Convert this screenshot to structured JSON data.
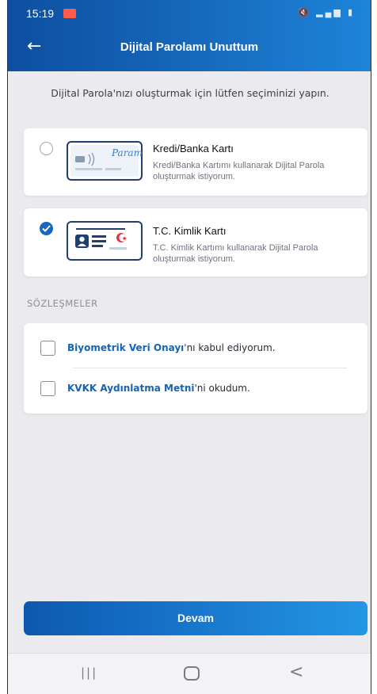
{
  "status_bar": {
    "time": "15:19"
  },
  "header": {
    "title": "Dijital Parolamı Unuttum",
    "back_icon": "arrow-left-icon"
  },
  "intro_text": "Dijital Parola'nızı oluşturmak için lütfen seçiminizi yapın.",
  "options": [
    {
      "title": "Kredi/Banka Kartı",
      "description": "Kredi/Banka Kartımı kullanarak Dijital Parola oluşturmak istiyorum.",
      "selected": false,
      "card_text": "Param"
    },
    {
      "title": "T.C. Kimlik Kartı",
      "description": "T.C. Kimlik Kartımı kullanarak Dijital Parola oluşturmak istiyorum.",
      "selected": true
    }
  ],
  "agreements": {
    "section_title": "SÖZLEŞMELER",
    "items": [
      {
        "link": "Biyometrik Veri Onayı",
        "rest": "'nı kabul ediyorum.",
        "checked": false
      },
      {
        "link": "KVKK Aydınlatma Metni",
        "rest": "'ni okudum.",
        "checked": false
      }
    ]
  },
  "continue_button": "Devam",
  "colors": {
    "primary": "#1766bf",
    "header_start": "#0d4fa0",
    "header_end": "#1d84d9",
    "background": "#eaeaef"
  },
  "navigation": {
    "recent_icon": "recent-apps-icon",
    "home_icon": "home-icon",
    "back_icon": "back-icon"
  }
}
